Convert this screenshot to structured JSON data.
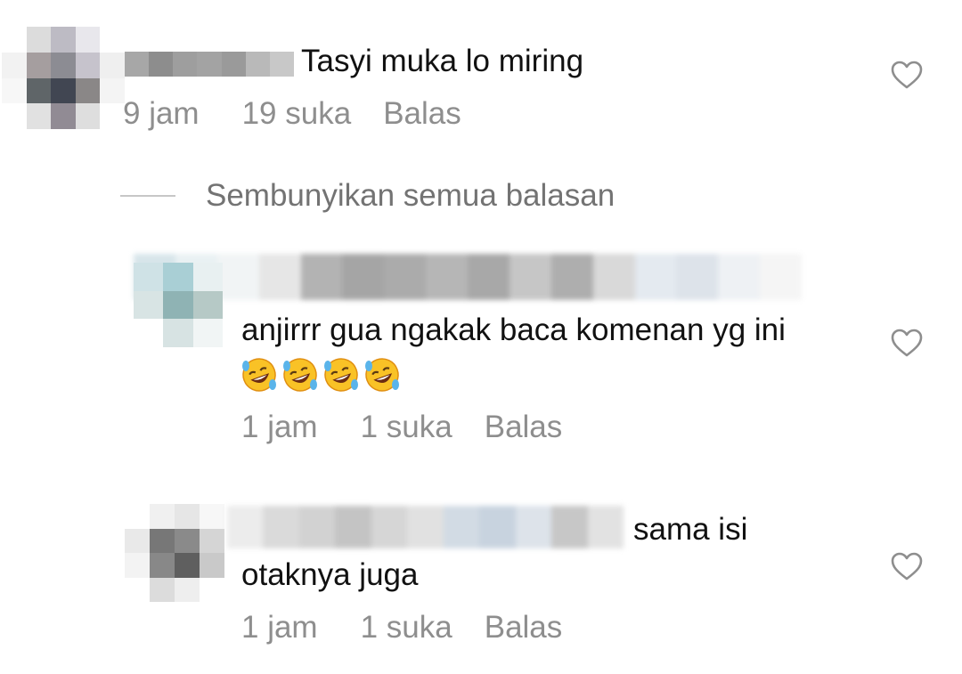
{
  "comments": [
    {
      "text": "Tasyi muka lo miring",
      "time": "9 jam",
      "likes": "19 suka",
      "reply_label": "Balas"
    },
    {
      "text_line1": "anjirrr gua ngakak baca komenan yg ini",
      "emojis": [
        "rofl-emoji",
        "rofl-emoji",
        "rofl-emoji",
        "rofl-emoji"
      ],
      "time": "1 jam",
      "likes": "1 suka",
      "reply_label": "Balas"
    },
    {
      "text_line1": "sama isi",
      "text_line2": "otaknya juga",
      "time": "1 jam",
      "likes": "1 suka",
      "reply_label": "Balas"
    }
  ],
  "hide_replies_label": "Sembunyikan semua balasan",
  "icons": {
    "like": "heart-outline-icon"
  },
  "colors": {
    "text": "#111111",
    "meta": "#8e8e8e",
    "hide_replies": "#737373",
    "divider": "#c7c7c7"
  }
}
